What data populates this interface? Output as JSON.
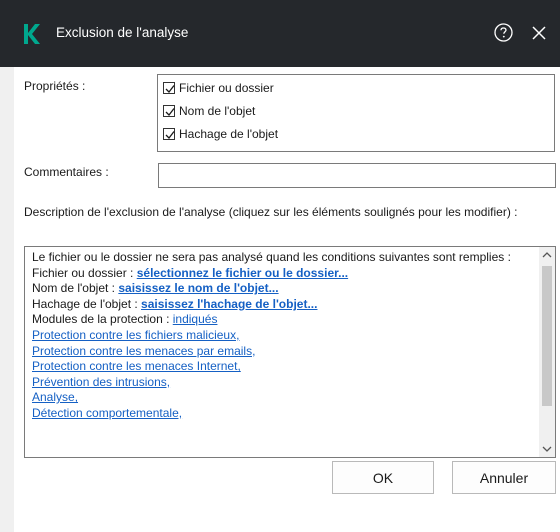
{
  "window": {
    "title": "Exclusion de l'analyse"
  },
  "properties": {
    "label": "Propriétés :",
    "options": [
      {
        "label": "Fichier ou dossier",
        "checked": true
      },
      {
        "label": "Nom de l'objet",
        "checked": true
      },
      {
        "label": "Hachage de l'objet",
        "checked": true
      }
    ]
  },
  "comments": {
    "label": "Commentaires :",
    "value": ""
  },
  "description": {
    "label": "Description de l'exclusion de l'analyse (cliquez sur les éléments soulignés pour les modifier) :",
    "intro": "Le fichier ou le dossier ne sera pas analysé quand les conditions suivantes sont remplies :",
    "file_label": "Fichier ou dossier : ",
    "file_link": "sélectionnez le fichier ou le dossier...",
    "name_label": "Nom de l'objet : ",
    "name_link": "saisissez le nom de l'objet...",
    "hash_label": "Hachage de l'objet : ",
    "hash_link": "saisissez l'hachage de l'objet...",
    "modules_label": "Modules de la protection : ",
    "modules_link": "indiqués",
    "modules": [
      "Protection contre les fichiers malicieux,",
      "Protection contre les menaces par emails,",
      "Protection contre les menaces Internet,",
      "Prévention des intrusions,",
      "Analyse,",
      "Détection comportementale,"
    ]
  },
  "buttons": {
    "ok": "OK",
    "cancel": "Annuler"
  },
  "colors": {
    "titlebar": "#25282c",
    "logo": "#00a88e",
    "link": "#1560c4"
  }
}
